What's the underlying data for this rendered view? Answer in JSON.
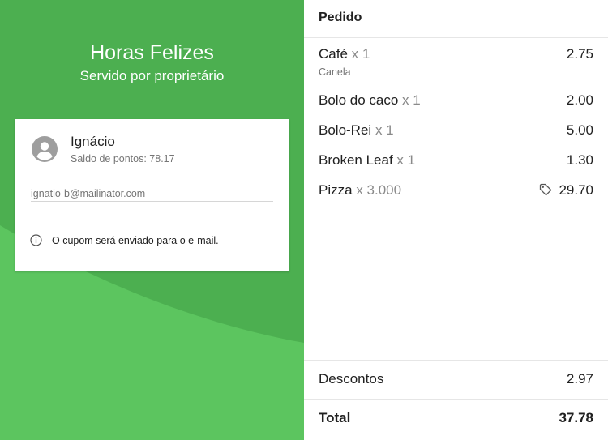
{
  "colors": {
    "accent": "#4caf50",
    "accent_light": "#5cc55f"
  },
  "store": {
    "title": "Horas Felizes",
    "subtitle": "Servido por proprietário"
  },
  "customer": {
    "name": "Ignácio",
    "points_label": "Saldo de pontos: 78.17",
    "email": "ignatio-b@mailinator.com",
    "avatar_icon": "account-circle-icon",
    "info_icon": "info-icon",
    "info_text": "O cupom será enviado para o e-mail."
  },
  "order": {
    "title": "Pedido",
    "items": [
      {
        "name": "Café",
        "qty": "x 1",
        "price": "2.75",
        "note": "Canela"
      },
      {
        "name": "Bolo do caco",
        "qty": "x 1",
        "price": "2.00"
      },
      {
        "name": "Bolo-Rei",
        "qty": "x 1",
        "price": "5.00"
      },
      {
        "name": "Broken Leaf",
        "qty": "x 1",
        "price": "1.30"
      },
      {
        "name": "Pizza",
        "qty": "x 3.000",
        "price": "29.70",
        "icon": "tag-icon"
      }
    ],
    "discount_label": "Descontos",
    "discount_value": "2.97",
    "total_label": "Total",
    "total_value": "37.78"
  }
}
